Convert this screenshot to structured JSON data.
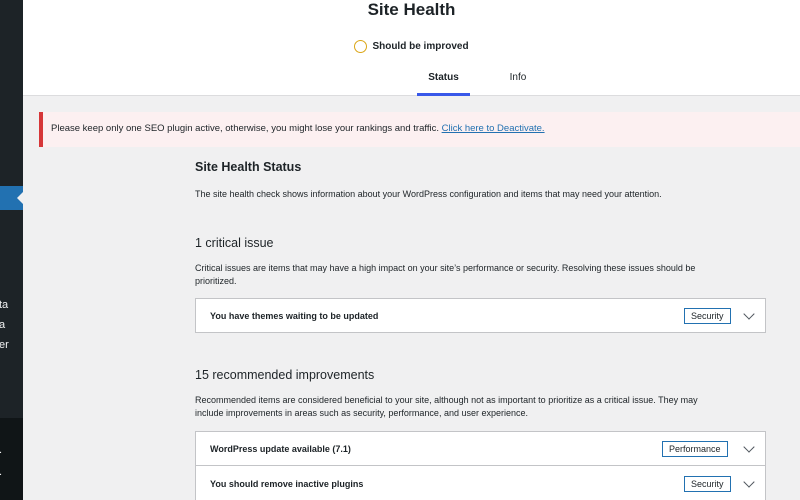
{
  "header": {
    "title": "Site Health",
    "status": "Should be improved",
    "tabs": [
      {
        "label": "Status",
        "active": true
      },
      {
        "label": "Info",
        "active": false
      }
    ]
  },
  "sidebar": {
    "fragments": [
      "ta",
      "a",
      "er"
    ],
    "bottom_dots": [
      ".",
      "."
    ]
  },
  "notice": {
    "text": "Please keep only one SEO plugin active, otherwise, you might lose your rankings and traffic.",
    "link": "Click here to Deactivate."
  },
  "status_section": {
    "heading": "Site Health Status",
    "description": "The site health check shows information about your WordPress configuration and items that may need your attention."
  },
  "critical": {
    "heading": "1 critical issue",
    "description_line1": "Critical issues are items that may have a high impact on your site’s performance or security. Resolving these issues should be",
    "description_line2": "prioritized.",
    "items": [
      {
        "label": "You have themes waiting to be updated",
        "badge": "Security"
      }
    ]
  },
  "recommended": {
    "heading": "15 recommended improvements",
    "description_line1": "Recommended items are considered beneficial to your site, although not as important to prioritize as a critical issue. They may",
    "description_line2": "include improvements in areas such as security, performance, and user experience.",
    "items": [
      {
        "label": "WordPress update available (7.1)",
        "badge": "Performance"
      },
      {
        "label": "You should remove inactive plugins",
        "badge": "Security"
      }
    ]
  },
  "colors": {
    "accent": "#3858e9",
    "badge_border": "#2271b1",
    "warning": "#dba617",
    "error": "#d63638"
  }
}
